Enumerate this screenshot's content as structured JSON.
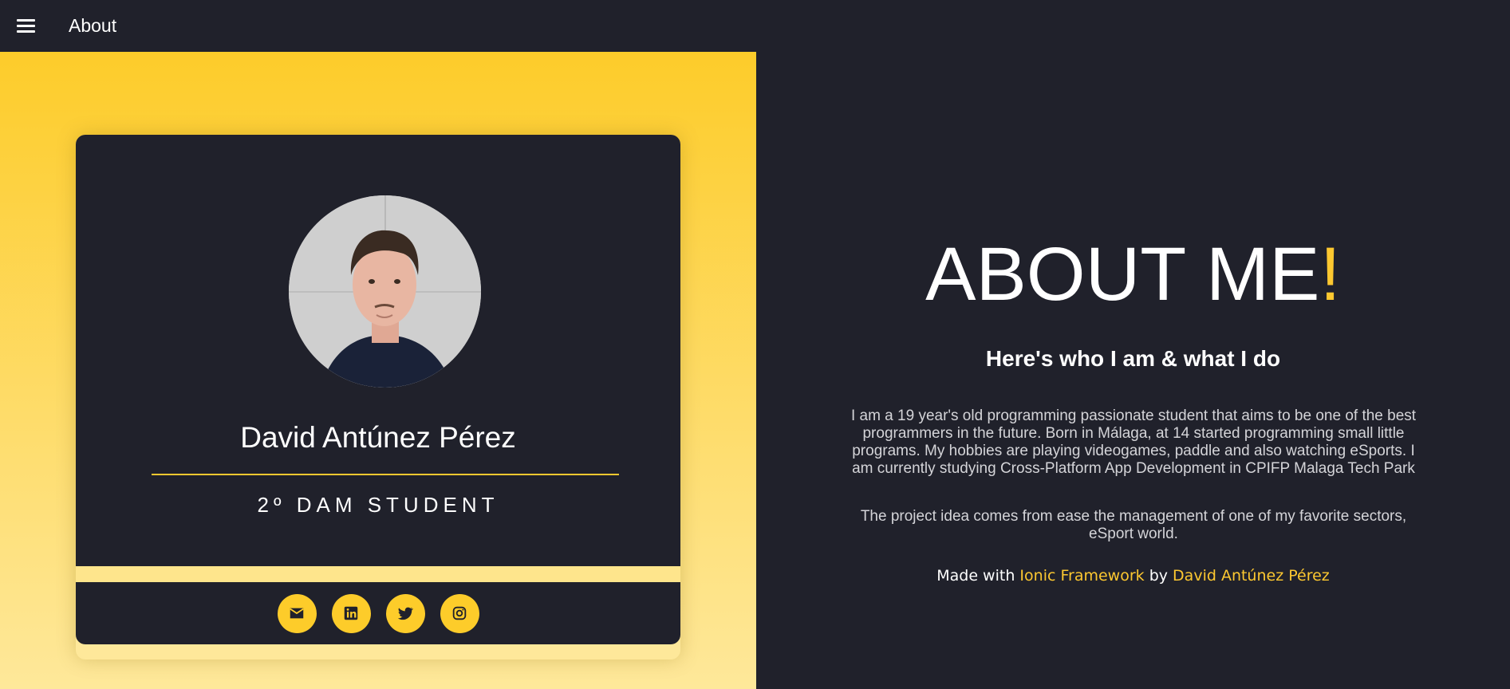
{
  "header": {
    "title": "About",
    "menu_icon": "menu-icon"
  },
  "profile": {
    "name": "David Antúnez Pérez",
    "role": "2º DAM STUDENT",
    "avatar_icon": "profile-photo"
  },
  "social": [
    {
      "name": "email-icon"
    },
    {
      "name": "linkedin-icon"
    },
    {
      "name": "twitter-icon"
    },
    {
      "name": "instagram-icon"
    }
  ],
  "about": {
    "heading": "ABOUT ME",
    "heading_accent": "!",
    "subheading": "Here's who I am & what I do",
    "bio": "I am a 19 year's old programming passionate student that aims to be one of the best programmers in the future. Born in Málaga, at 14 started programming small little programs. My hobbies are playing videogames, paddle and also watching eSports. I am currently studying Cross-Platform App Development in CPIFP Malaga Tech Park",
    "project": "The project idea comes from ease the management of one of my favorite sectors, eSport world.",
    "credit": {
      "prefix": "Made with",
      "framework": "Ionic Framework",
      "by": "by",
      "author": "David Antúnez Pérez"
    }
  },
  "colors": {
    "accent": "#fdc830",
    "background": "#20212b",
    "gradient_top": "#fdcc2a",
    "gradient_bottom": "#fee89a"
  }
}
